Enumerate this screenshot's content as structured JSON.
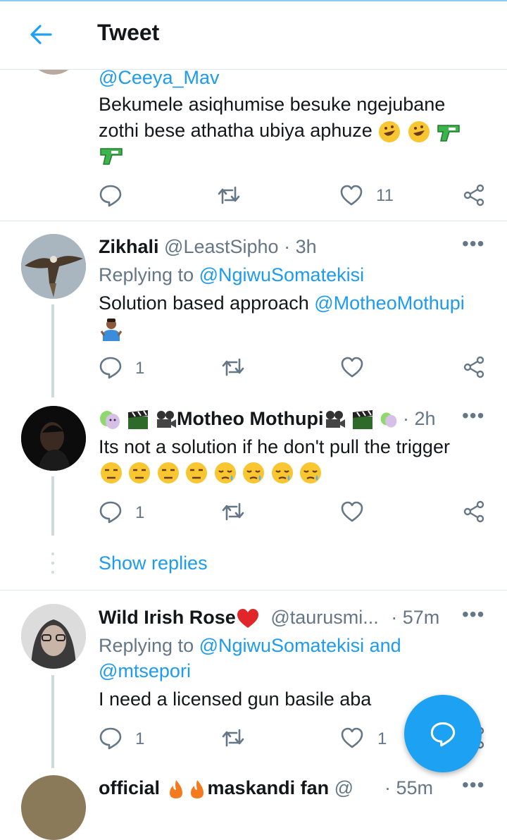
{
  "header": {
    "title": "Tweet",
    "back_label": "Back"
  },
  "tweet0": {
    "mention": "@Ceeya_Mav",
    "text_line1": "Bekumele asiqhumise besuke ngejubane",
    "text_line2": "zothi bese athatha ubiya aphuze",
    "likes": "11"
  },
  "tweet1": {
    "name": "Zikhali",
    "handle": "@LeastSipho",
    "time": "· 3h",
    "replying_prefix": "Replying to",
    "replying_to": "@NgiwuSomatekisi",
    "text": "Solution based approach",
    "mention": "@MotheoMothupi",
    "replies": "1"
  },
  "tweet2": {
    "name": "Motheo Mothupi",
    "time": "· 2h",
    "text": "Its not a solution if he don't pull the trigger",
    "replies": "1"
  },
  "show_replies": "Show replies",
  "tweet3": {
    "name": "Wild Irish Rose",
    "handle": "@taurusmi...",
    "time": "· 57m",
    "replying_prefix": "Replying to",
    "replying_to": "@NgiwuSomatekisi and",
    "replying_to2": "@mtsepori",
    "text": "I need a licensed gun basile aba",
    "replies": "1",
    "likes": "1"
  },
  "tweet4": {
    "name_start": "official",
    "name_end": "maskandi fan",
    "handle": "@",
    "time": "· 55m"
  },
  "colors": {
    "accent": "#1da1f2",
    "link": "#1d9bf0",
    "muted": "#657786"
  }
}
